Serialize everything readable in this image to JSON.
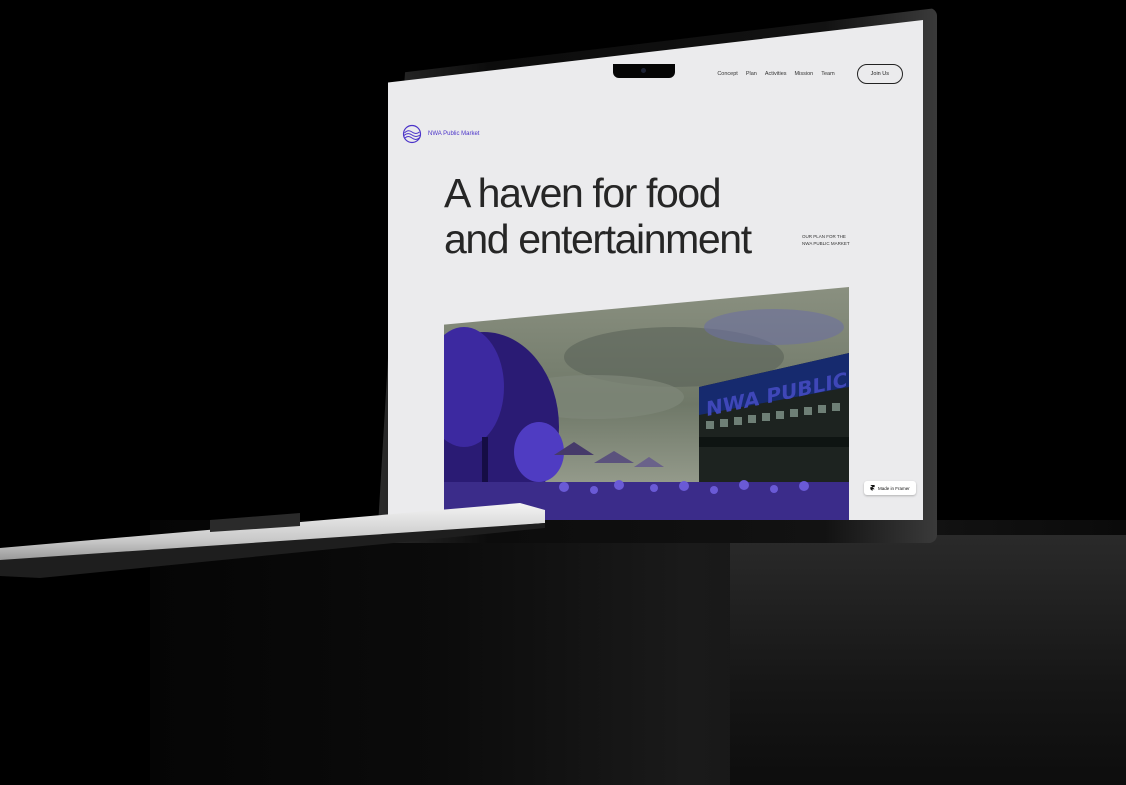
{
  "site": {
    "brand": "NWA Public Market",
    "nav_items": [
      "Concept",
      "Plan",
      "Activities",
      "Mission",
      "Team"
    ],
    "cta_label": "Join Us",
    "headline_line1": "A haven for food",
    "headline_line2": "and entertainment",
    "aside_line1": "OUR PLAN FOR THE",
    "aside_line2": "NWA PUBLIC MARKET",
    "hero_sign": "NWA PUBLIC MARK",
    "badge_label": "Made in Framer"
  },
  "colors": {
    "accent": "#4b33c9",
    "screen_bg": "#ebebed",
    "text": "#262626"
  },
  "icons": {
    "logo": "globe-wave-logo-icon",
    "badge": "framer-icon"
  }
}
